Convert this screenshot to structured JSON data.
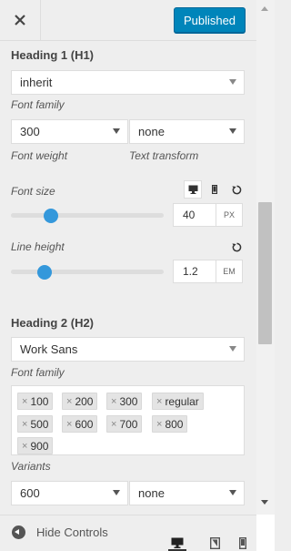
{
  "header": {
    "close_icon": "close-icon",
    "publish_label": "Published"
  },
  "heading1": {
    "title": "Heading 1 (H1)",
    "font_family_value": "inherit",
    "font_family_label": "Font family",
    "font_weight_value": "300",
    "font_weight_label": "Font weight",
    "text_transform_value": "none",
    "text_transform_label": "Text transform",
    "font_size_label": "Font size",
    "font_size_value": "40",
    "font_size_unit": "PX",
    "font_size_fraction": 0.26,
    "line_height_label": "Line height",
    "line_height_value": "1.2",
    "line_height_unit": "EM",
    "line_height_fraction": 0.22
  },
  "heading2": {
    "title": "Heading 2 (H2)",
    "font_family_value": "Work Sans",
    "font_family_label": "Font family",
    "variants": [
      "100",
      "200",
      "300",
      "regular",
      "500",
      "600",
      "700",
      "800",
      "900"
    ],
    "variants_label": "Variants",
    "font_weight_value": "600",
    "text_transform_value": "none"
  },
  "footer": {
    "hide_controls_label": "Hide Controls"
  },
  "colors": {
    "accent": "#3498db",
    "publish": "#0085ba"
  }
}
